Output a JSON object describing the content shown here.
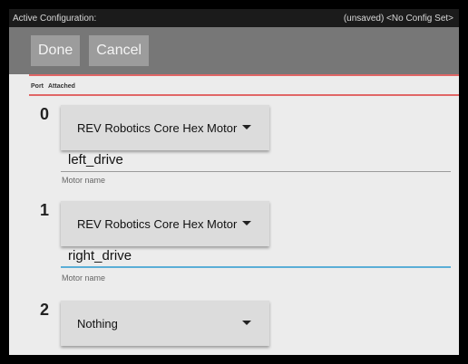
{
  "status": {
    "left": "Active Configuration:",
    "right": "(unsaved) <No Config Set>"
  },
  "toolbar": {
    "done_label": "Done",
    "cancel_label": "Cancel"
  },
  "table_header": {
    "port": "Port",
    "attached": "Attached"
  },
  "ports": [
    {
      "number": "0",
      "device": "REV Robotics Core Hex Motor",
      "name": "left_drive",
      "name_label": "Motor name"
    },
    {
      "number": "1",
      "device": "REV Robotics Core Hex Motor",
      "name": "right_drive",
      "name_label": "Motor name"
    },
    {
      "number": "2",
      "device": "Nothing"
    }
  ],
  "colors": {
    "accent": "#5aaed6",
    "divider": "#e06666",
    "toolbar": "#777777"
  },
  "icons": {
    "dropdown": "caret-down-icon"
  }
}
